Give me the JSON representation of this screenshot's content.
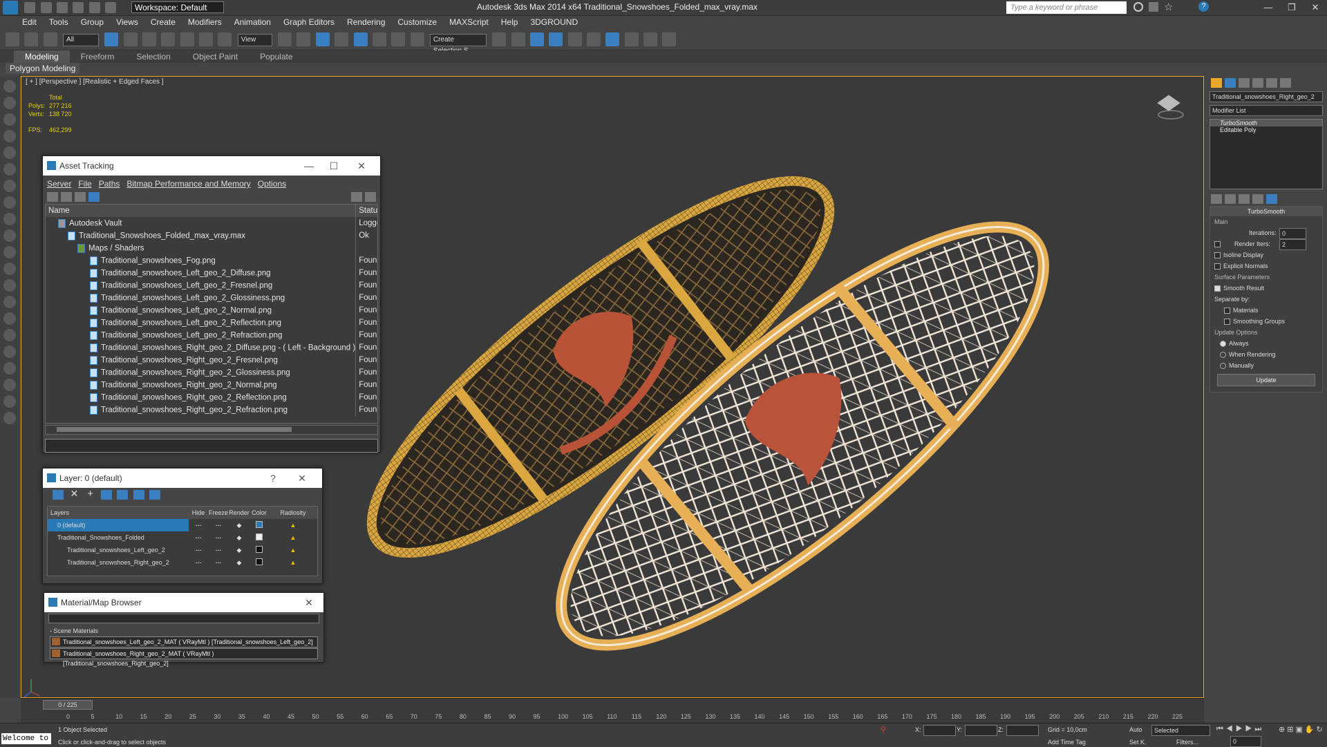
{
  "titlebar": {
    "workspace": "Workspace: Default",
    "title": "Autodesk 3ds Max  2014 x64     Traditional_Snowshoes_Folded_max_vray.max",
    "search_placeholder": "Type a keyword or phrase"
  },
  "menu": [
    "Edit",
    "Tools",
    "Group",
    "Views",
    "Create",
    "Modifiers",
    "Animation",
    "Graph Editors",
    "Rendering",
    "Customize",
    "MAXScript",
    "Help",
    "3DGROUND"
  ],
  "toolbar": {
    "filter": "All",
    "ref_coord": "View",
    "named_sel": "Create Selection S"
  },
  "ribbon": {
    "tabs": [
      "Modeling",
      "Freeform",
      "Selection",
      "Object Paint",
      "Populate"
    ],
    "active": "Modeling",
    "subtab": "Polygon Modeling"
  },
  "viewport": {
    "label": "[ + ] [Perspective ] [Realistic + Edged Faces ]",
    "stats_header": "Total",
    "polys_label": "Polys:",
    "polys": "277 216",
    "verts_label": "Verts:",
    "verts": "138 720",
    "fps_label": "FPS:",
    "fps": "462,299"
  },
  "asset_tracking": {
    "title": "Asset Tracking",
    "menu": [
      "Server",
      "File",
      "Paths",
      "Bitmap Performance and Memory",
      "Options"
    ],
    "col_name": "Name",
    "col_status": "Status",
    "rows": [
      {
        "name": "Autodesk Vault",
        "status": "Logge"
      },
      {
        "name": "Traditional_Snowshoes_Folded_max_vray.max",
        "status": "Ok"
      },
      {
        "name": "Maps / Shaders",
        "status": ""
      },
      {
        "name": "Traditional_snowshoes_Fog.png",
        "status": "Found"
      },
      {
        "name": "Traditional_snowshoes_Left_geo_2_Diffuse.png",
        "status": "Found"
      },
      {
        "name": "Traditional_snowshoes_Left_geo_2_Fresnel.png",
        "status": "Found"
      },
      {
        "name": "Traditional_snowshoes_Left_geo_2_Glossiness.png",
        "status": "Found"
      },
      {
        "name": "Traditional_snowshoes_Left_geo_2_Normal.png",
        "status": "Found"
      },
      {
        "name": "Traditional_snowshoes_Left_geo_2_Reflection.png",
        "status": "Found"
      },
      {
        "name": "Traditional_snowshoes_Left_geo_2_Refraction.png",
        "status": "Found"
      },
      {
        "name": "Traditional_snowshoes_Right_geo_2_Diffuse.png - ( Left - Background )",
        "status": "Found"
      },
      {
        "name": "Traditional_snowshoes_Right_geo_2_Fresnel.png",
        "status": "Found"
      },
      {
        "name": "Traditional_snowshoes_Right_geo_2_Glossiness.png",
        "status": "Found"
      },
      {
        "name": "Traditional_snowshoes_Right_geo_2_Normal.png",
        "status": "Found"
      },
      {
        "name": "Traditional_snowshoes_Right_geo_2_Reflection.png",
        "status": "Found"
      },
      {
        "name": "Traditional_snowshoes_Right_geo_2_Refraction.png",
        "status": "Found"
      }
    ]
  },
  "layer": {
    "title": "Layer: 0 (default)",
    "help": "?",
    "cols": [
      "Layers",
      "Hide",
      "Freeze",
      "Render",
      "Color",
      "Radiosity"
    ],
    "rows": [
      "0 (default)",
      "Traditional_Snowshoes_Folded",
      "Traditional_snowshoes_Left_geo_2",
      "Traditional_snowshoes_Right_geo_2"
    ]
  },
  "material_browser": {
    "title": "Material/Map Browser",
    "group": "- Scene Materials",
    "items": [
      "Traditional_snowshoes_Left_geo_2_MAT ( VRayMtl ) [Traditional_snowshoes_Left_geo_2]",
      "Traditional_snowshoes_Right_geo_2_MAT ( VRayMtl ) [Traditional_snowshoes_Right_geo_2]"
    ]
  },
  "command_panel": {
    "object_name": "Traditional_snowshoes_Right_geo_2",
    "modifier_list": "Modifier List",
    "stack": [
      "TurboSmooth",
      "Editable Poly"
    ],
    "rollout_title": "TurboSmooth",
    "main_label": "Main",
    "iterations_label": "Iterations:",
    "iterations": "0",
    "render_iters_label": "Render Iters:",
    "render_iters": "2",
    "isoline": "Isoline Display",
    "explicit_normals": "Explicit Normals",
    "surface_params": "Surface Parameters",
    "smooth_result": "Smooth Result",
    "separate_by": "Separate by:",
    "materials": "Materials",
    "smoothing_groups": "Smoothing Groups",
    "update_options": "Update Options",
    "always": "Always",
    "when_rendering": "When Rendering",
    "manually": "Manually",
    "update_button": "Update"
  },
  "timeline": {
    "frame": "0 / 225",
    "ticks": [
      "0",
      "5",
      "10",
      "15",
      "20",
      "25",
      "30",
      "35",
      "40",
      "45",
      "50",
      "55",
      "60",
      "65",
      "70",
      "75",
      "80",
      "85",
      "90",
      "95",
      "100",
      "105",
      "110",
      "115",
      "120",
      "125",
      "130",
      "135",
      "140",
      "145",
      "150",
      "155",
      "160",
      "165",
      "170",
      "175",
      "180",
      "185",
      "190",
      "195",
      "200",
      "205",
      "210",
      "215",
      "220",
      "225"
    ]
  },
  "status": {
    "welcome": "Welcome to",
    "selected": "1 Object Selected",
    "prompt": "Click or click-and-drag to select objects",
    "x_label": "X:",
    "y_label": "Y:",
    "z_label": "Z:",
    "grid": "Grid = 10,0cm",
    "add_time_tag": "Add Time Tag",
    "auto": "Auto",
    "set_key": "Set K.",
    "key_mode": "Selected",
    "filters": "Filters...",
    "frame_field": "0"
  }
}
